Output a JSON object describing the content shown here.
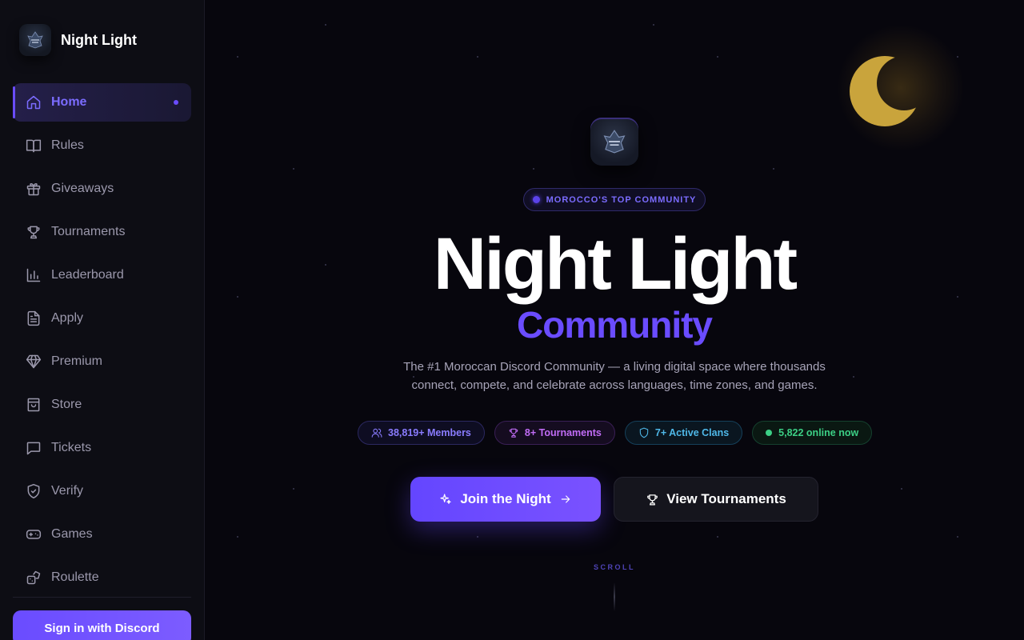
{
  "brand": {
    "name": "Night Light"
  },
  "sidebar": {
    "items": [
      {
        "label": "Home",
        "icon": "home-icon",
        "active": true
      },
      {
        "label": "Rules",
        "icon": "book-icon"
      },
      {
        "label": "Giveaways",
        "icon": "gift-icon"
      },
      {
        "label": "Tournaments",
        "icon": "trophy-icon"
      },
      {
        "label": "Leaderboard",
        "icon": "bar-chart-icon"
      },
      {
        "label": "Apply",
        "icon": "document-icon"
      },
      {
        "label": "Premium",
        "icon": "diamond-icon"
      },
      {
        "label": "Store",
        "icon": "shopping-bag-icon"
      },
      {
        "label": "Tickets",
        "icon": "message-icon"
      },
      {
        "label": "Verify",
        "icon": "shield-check-icon"
      },
      {
        "label": "Games",
        "icon": "gamepad-icon"
      },
      {
        "label": "Roulette",
        "icon": "dice-icon"
      }
    ],
    "signin_label": "Sign in with Discord"
  },
  "hero": {
    "badge": "MOROCCO'S TOP COMMUNITY",
    "title": "Night Light",
    "subtitle": "Community",
    "description": "The #1 Moroccan Discord Community — a living digital space where thousands connect, compete, and celebrate across languages, time zones, and games.",
    "stats": {
      "members": "38,819+ Members",
      "tournaments": "8+ Tournaments",
      "clans": "7+ Active Clans",
      "online": "5,822 online now"
    },
    "join_label": "Join the Night",
    "tournaments_label": "View Tournaments",
    "scroll_label": "SCROLL"
  },
  "colors": {
    "accent": "#6a4cff",
    "background": "#07060d",
    "sidebar": "#0d0d14",
    "moon": "#c9a43c",
    "online": "#3ccf85"
  }
}
